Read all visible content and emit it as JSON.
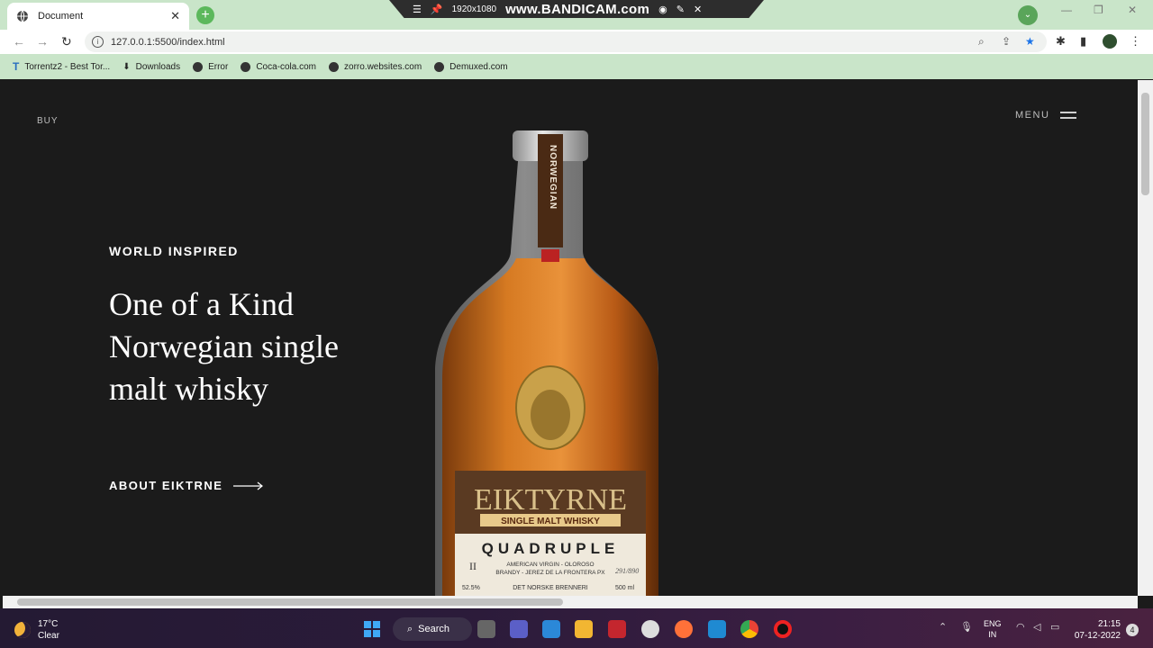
{
  "browser": {
    "tab_title": "Document",
    "url": "127.0.0.1:5500/index.html",
    "recorder": {
      "resolution": "1920x1080",
      "brand": "www.BANDICAM.com"
    },
    "bookmarks": [
      {
        "label": "Torrentz2 - Best Tor...",
        "icon": "torrentz-icon"
      },
      {
        "label": "Downloads",
        "icon": "download-icon"
      },
      {
        "label": "Error",
        "icon": "globe-icon"
      },
      {
        "label": "Coca-cola.com",
        "icon": "globe-icon"
      },
      {
        "label": "zorro.websites.com",
        "icon": "globe-icon"
      },
      {
        "label": "Demuxed.com",
        "icon": "globe-icon"
      }
    ]
  },
  "page": {
    "buy_label": "BUY",
    "menu_label": "MENU",
    "eyebrow": "WORLD INSPIRED",
    "headline_lines": [
      "One of a Kind",
      "Norwegian single",
      "malt whisky"
    ],
    "cta_label": "ABOUT EIKTRNE",
    "bottle": {
      "neck_label": "NORWEGIAN",
      "brand": "EIKTYRNE",
      "subtitle": "SINGLE MALT WHISKY",
      "name": "QUADRUPLE",
      "numeral": "II",
      "desc_line1": "AMERICAN VIRGIN - OLOROSO",
      "desc_line2": "BRANDY - JEREZ DE LA FRONTERA PX",
      "abv": "52.5%",
      "maker": "DET NORSKE BRENNERI",
      "batch": "291/890",
      "volume": "500 ml"
    },
    "colors": {
      "background": "#1b1b1b",
      "text": "#ffffff",
      "whisky": "#c8651a"
    }
  },
  "taskbar": {
    "temperature": "17°C",
    "condition": "Clear",
    "search_label": "Search",
    "lang_line1": "ENG",
    "lang_line2": "IN",
    "time": "21:15",
    "date": "07-12-2022",
    "notification_count": "4"
  }
}
